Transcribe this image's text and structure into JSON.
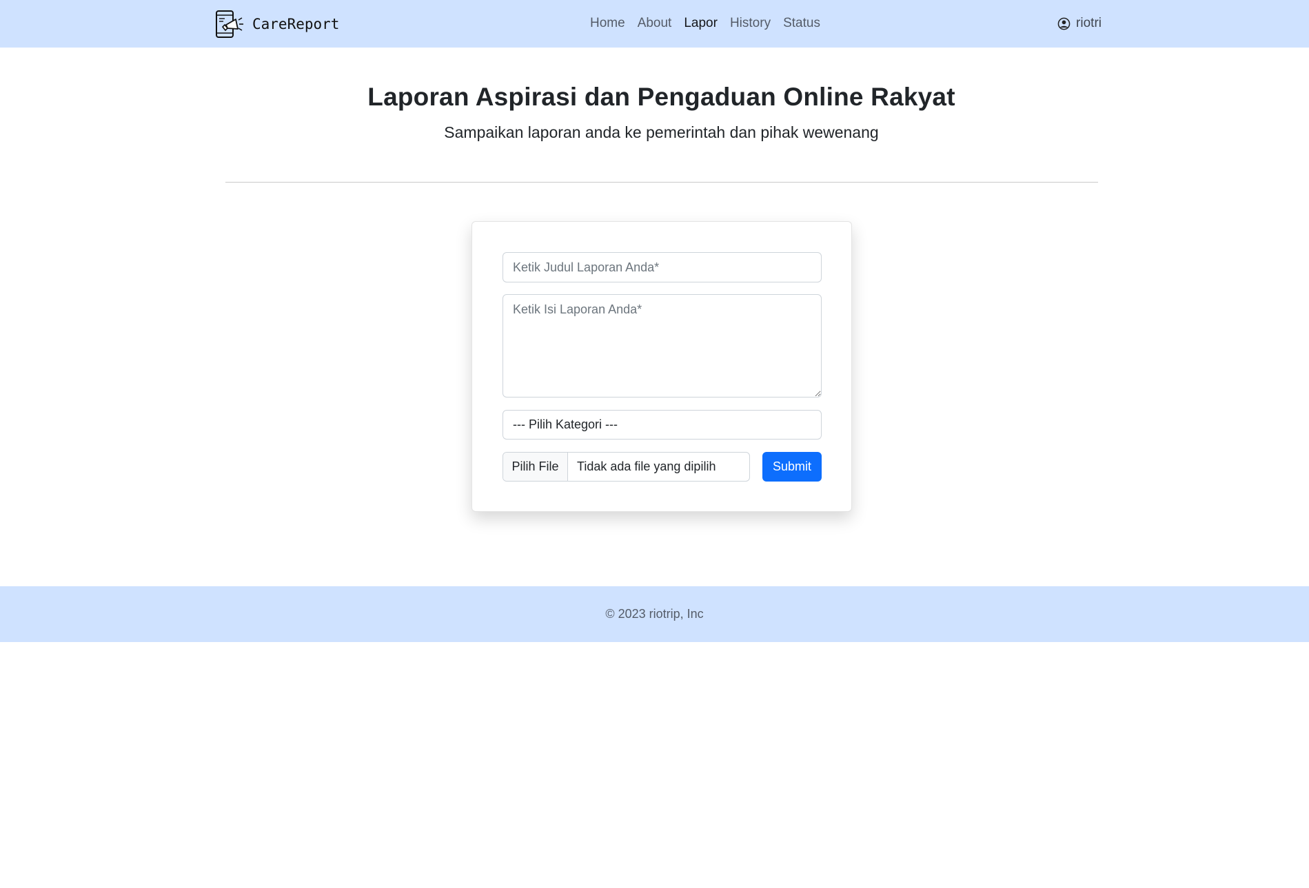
{
  "brand": {
    "name": "CareReport",
    "logo_icon": "megaphone-phone-icon"
  },
  "nav": {
    "links": [
      {
        "label": "Home",
        "active": false
      },
      {
        "label": "About",
        "active": false
      },
      {
        "label": "Lapor",
        "active": true
      },
      {
        "label": "History",
        "active": false
      },
      {
        "label": "Status",
        "active": false
      }
    ]
  },
  "user": {
    "name": "riotri",
    "icon": "user-circle-icon"
  },
  "hero": {
    "title": "Laporan Aspirasi dan Pengaduan Online Rakyat",
    "subtitle": "Sampaikan laporan anda ke pemerintah dan pihak wewenang"
  },
  "form": {
    "title_placeholder": "Ketik Judul Laporan Anda*",
    "title_value": "",
    "content_placeholder": "Ketik Isi Laporan Anda*",
    "content_value": "",
    "category_selected": "--- Pilih Kategori ---",
    "file_button_label": "Pilih File",
    "file_status": "Tidak ada file yang dipilih",
    "submit_label": "Submit"
  },
  "footer": {
    "text": "© 2023 riotrip, Inc"
  },
  "colors": {
    "navbar_bg": "#cfe2ff",
    "primary": "#0d6efd",
    "footer_bg": "#cfe2ff"
  }
}
